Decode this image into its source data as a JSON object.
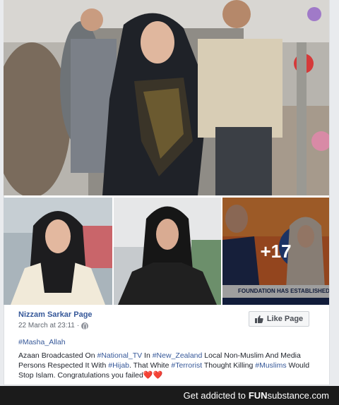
{
  "post": {
    "page_name": "Nizzam Sarkar Page",
    "timestamp": "22 March at 23:11",
    "separator": "·",
    "like_button_label": "Like Page",
    "more_photos": "+17",
    "ticker_text": "FOUNDATION HAS ESTABLISHED NEW FUND FOR PEOPLE OF...",
    "text": {
      "line1_tag": "#Masha_Allah",
      "p2_a": "Azaan Broadcasted On ",
      "p2_tag1": "#National_TV",
      "p2_b": " In ",
      "p2_tag2": "#New_Zealand",
      "p2_c": " Local Non-Muslim And Media Persons Respected It With ",
      "p2_tag3": "#Hijab",
      "p2_d": ". That White ",
      "p2_tag4": "#Terrorist",
      "p2_e": " Thought Killing ",
      "p2_tag5": "#Muslims",
      "p2_f": " Would Stop Islam. Congratulations you failed",
      "hearts": "❤️❤️"
    }
  },
  "footer": {
    "prefix": "Get addicted to",
    "brand_main": "FUN",
    "brand_sub": "substance",
    "brand_tld": ".com"
  },
  "colors": {
    "link": "#365899",
    "footer_bg": "#1b1b1b",
    "heart": "#e5384f"
  }
}
